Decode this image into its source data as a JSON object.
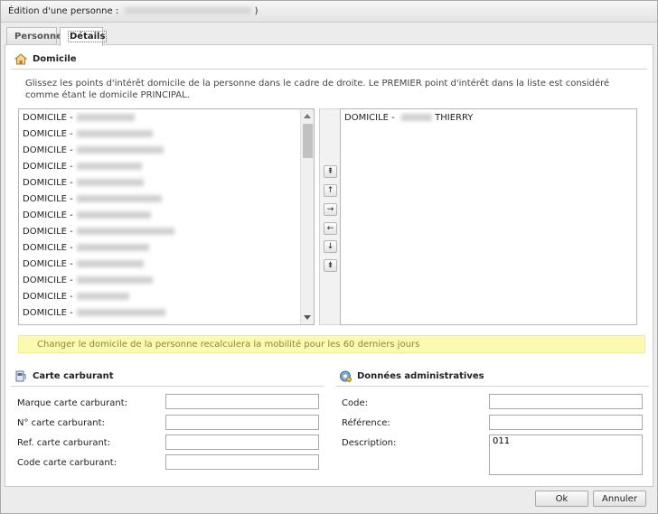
{
  "window": {
    "title_prefix": "Édition d'une personne :",
    "title_suffix": ")"
  },
  "tabs": [
    {
      "label": "Personne",
      "active": false
    },
    {
      "label": "Détails",
      "active": true
    }
  ],
  "domicile": {
    "header": "Domicile",
    "description": "Glissez les points d'intérêt domicile de la personne dans le cadre de droite. Le PREMIER point d'intérêt dans la liste est considéré comme étant le domicile PRINCIPAL.",
    "available_items": [
      "DOMICILE -",
      "DOMICILE -",
      "DOMICILE -",
      "DOMICILE -",
      "DOMICILE -",
      "DOMICILE -",
      "DOMICILE -",
      "DOMICILE -",
      "DOMICILE -",
      "DOMICILE -",
      "DOMICILE -",
      "DOMICILE -",
      "DOMICILE -"
    ],
    "selected_items": [
      {
        "prefix": "DOMICILE -",
        "name": "THIERRY"
      }
    ],
    "move_buttons": [
      {
        "name": "move-top-button",
        "glyph": "⇞"
      },
      {
        "name": "move-up-button",
        "glyph": "↑"
      },
      {
        "name": "move-right-button",
        "glyph": "→"
      },
      {
        "name": "move-left-button",
        "glyph": "←"
      },
      {
        "name": "move-down-button",
        "glyph": "↓"
      },
      {
        "name": "move-bottom-button",
        "glyph": "⇟"
      }
    ],
    "notice": "Changer le domicile de la personne recalculera la mobilité pour les 60 derniers jours"
  },
  "carte_carburant": {
    "header": "Carte carburant",
    "fields": [
      {
        "label": "Marque carte carburant:",
        "value": ""
      },
      {
        "label": "N° carte carburant:",
        "value": ""
      },
      {
        "label": "Ref. carte carburant:",
        "value": ""
      },
      {
        "label": "Code carte carburant:",
        "value": ""
      }
    ]
  },
  "donnees_admin": {
    "header": "Données administratives",
    "code_label": "Code:",
    "code_value": "",
    "reference_label": "Référence:",
    "reference_value": "",
    "description_label": "Description:",
    "description_value": "011"
  },
  "footer": {
    "ok_label": "Ok",
    "cancel_label": "Annuler"
  }
}
